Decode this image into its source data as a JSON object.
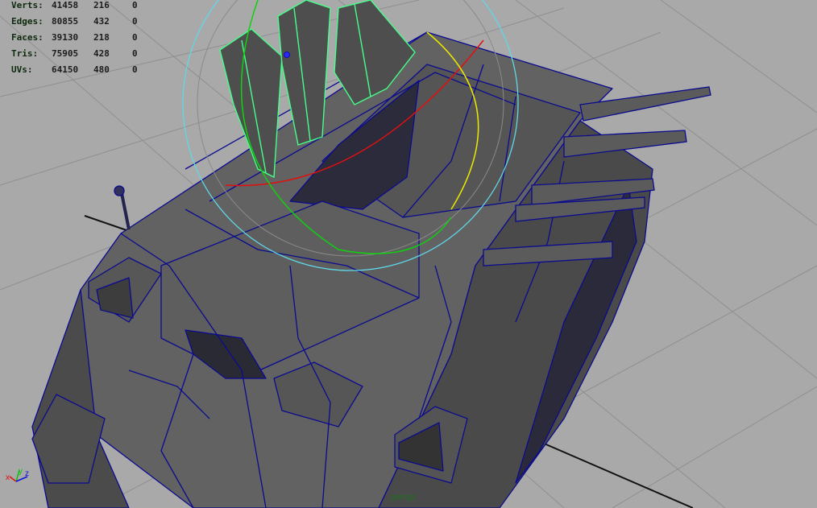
{
  "heads_up_display": {
    "rows": [
      {
        "label": "Verts:",
        "values": [
          "41458",
          "216",
          "0"
        ]
      },
      {
        "label": "Edges:",
        "values": [
          "80855",
          "432",
          "0"
        ]
      },
      {
        "label": "Faces:",
        "values": [
          "39130",
          "218",
          "0"
        ]
      },
      {
        "label": "Tris:",
        "values": [
          "75905",
          "428",
          "0"
        ]
      },
      {
        "label": "UVs:",
        "values": [
          "64150",
          "480",
          "0"
        ]
      }
    ]
  },
  "viewport": {
    "camera": "persp",
    "axis_gizmo": {
      "x": "x",
      "y": "y",
      "z": "z"
    }
  },
  "colors": {
    "background": "#a9a9a9",
    "grid": "#8e8e8e",
    "mesh_face": "#5a5a5a",
    "mesh_wire": "#0a0a9a",
    "selected_wire": "#44ff88",
    "rotate_x": "#e01010",
    "rotate_y": "#10d010",
    "rotate_z": "#e8e800",
    "rotate_view": "#60d8e8"
  }
}
